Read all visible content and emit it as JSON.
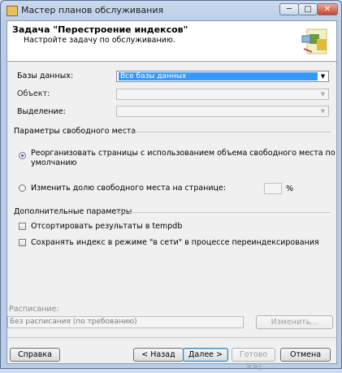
{
  "window": {
    "title": "Мастер планов обслуживания",
    "minimize": "─",
    "maximize": "□",
    "close": "✕"
  },
  "header": {
    "title": "Задача \"Перестроение индексов\"",
    "subtitle": "Настройте задачу по обслуживанию."
  },
  "fields": {
    "databases": {
      "label": "Базы данных:",
      "value": "Все базы данных"
    },
    "object": {
      "label": "Объект:",
      "value": ""
    },
    "selection": {
      "label": "Выделение:",
      "value": ""
    }
  },
  "free_space": {
    "title": "Параметры свободного места",
    "option1_line1": "Реорганизовать страницы с использованием объема свободного места по",
    "option1_line2": "умолчанию",
    "option2": "Изменить долю свободного места на странице:",
    "percent_value": "",
    "percent_unit": "%",
    "selected": "option1"
  },
  "advanced": {
    "title": "Дополнительные параметры",
    "sort_tempdb": "Отсортировать результаты в tempdb",
    "keep_online": "Сохранять индекс в режиме \"в сети\" в процессе переиндексирования"
  },
  "schedule": {
    "label": "Расписание:",
    "value": "Без расписания (по требованию)",
    "change": "Изменить..."
  },
  "buttons": {
    "help": "Справка",
    "back": "< Назад",
    "next": "Далее >",
    "finish": "Готово >>|",
    "cancel": "Отмена"
  }
}
